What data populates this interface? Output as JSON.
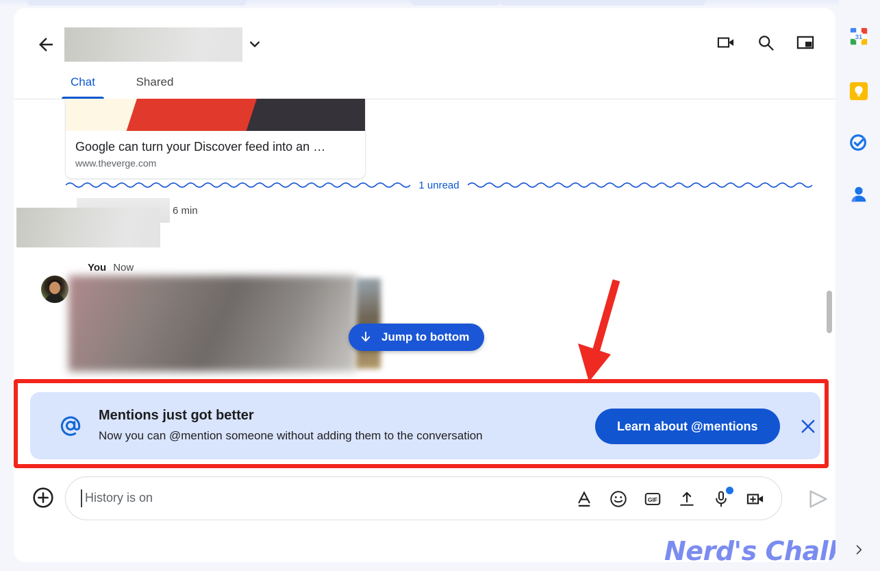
{
  "header": {
    "back_icon": "back-arrow-icon",
    "title_redacted": "",
    "chevron_icon": "chevron-down-icon",
    "actions": [
      {
        "name": "video-call-icon",
        "label": "Video call"
      },
      {
        "name": "search-icon",
        "label": "Search"
      },
      {
        "name": "picture-in-picture-icon",
        "label": "Open in pop-out"
      }
    ]
  },
  "tabs": [
    {
      "id": "chat",
      "label": "Chat",
      "active": true
    },
    {
      "id": "shared",
      "label": "Shared",
      "active": false
    }
  ],
  "messages": {
    "link_card": {
      "title": "Google can turn your Discover feed into an …",
      "url": "www.theverge.com"
    },
    "unread_divider": "1 unread",
    "incoming": {
      "sender_redacted": "",
      "timestamp": "6 min"
    },
    "outgoing": {
      "sender": "You",
      "timestamp": "Now"
    },
    "jump_button": {
      "label": "Jump to bottom",
      "icon": "arrow-down-icon"
    }
  },
  "banner": {
    "icon": "at-mention-icon",
    "title": "Mentions just got better",
    "subtitle": "Now you can @mention someone without adding them to the conversation",
    "cta_label": "Learn about @mentions",
    "close_icon": "close-icon",
    "highlight_color": "#f3251b",
    "background_color": "#d9e4fd",
    "cta_color": "#1155d1"
  },
  "composer": {
    "add_icon": "plus-circle-icon",
    "placeholder": "History is on",
    "value": "",
    "tools": [
      {
        "name": "format-text-icon",
        "label": "Format"
      },
      {
        "name": "emoji-icon",
        "label": "Emoji"
      },
      {
        "name": "gif-icon",
        "label": "GIF"
      },
      {
        "name": "upload-icon",
        "label": "Upload file"
      },
      {
        "name": "microphone-icon",
        "label": "Voice message",
        "badge": true
      },
      {
        "name": "add-video-icon",
        "label": "Add video"
      }
    ],
    "send_icon": "send-icon"
  },
  "watermark": "Nerd's Chalk",
  "side_rail": [
    {
      "name": "google-calendar-icon",
      "label": "Calendar",
      "badge": "31"
    },
    {
      "name": "google-keep-icon",
      "label": "Keep"
    },
    {
      "name": "google-tasks-icon",
      "label": "Tasks"
    },
    {
      "name": "google-contacts-icon",
      "label": "Contacts"
    }
  ],
  "rail_expand_icon": "chevron-right-icon"
}
